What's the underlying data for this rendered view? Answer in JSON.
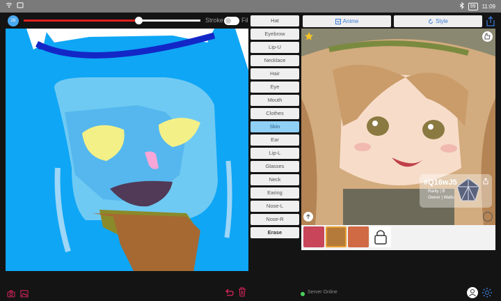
{
  "status_bar": {
    "battery": "99",
    "time": "11:09"
  },
  "toolbar": {
    "brush_size": "28",
    "stroke_label": "Stroke",
    "fill_label": "Fill"
  },
  "parts": [
    {
      "label": "Hat"
    },
    {
      "label": "Eyebrow"
    },
    {
      "label": "Lip-U"
    },
    {
      "label": "Necklace"
    },
    {
      "label": "Hair"
    },
    {
      "label": "Eye"
    },
    {
      "label": "Mouth"
    },
    {
      "label": "Clothes"
    },
    {
      "label": "Skin",
      "active": true
    },
    {
      "label": "Ear"
    },
    {
      "label": "Lip-L"
    },
    {
      "label": "Glasses"
    },
    {
      "label": "Neck"
    },
    {
      "label": "Earing"
    },
    {
      "label": "Nose-L"
    },
    {
      "label": "Nose-R"
    }
  ],
  "erase_label": "Erase",
  "right_panel": {
    "anime_label": "Anime",
    "style_label": "Style",
    "card": {
      "id": "#Q16wJ5",
      "rarity": "Rarity | B",
      "owner": "Owner | Waifu"
    }
  },
  "footer": {
    "server_status": "Server Online"
  },
  "colors": {
    "accent": "#3a7bd5",
    "slider": "#e01f1f",
    "active_part": "#8fd0f7",
    "server_ok": "#4bd35b",
    "icon_red": "#e0245e"
  }
}
